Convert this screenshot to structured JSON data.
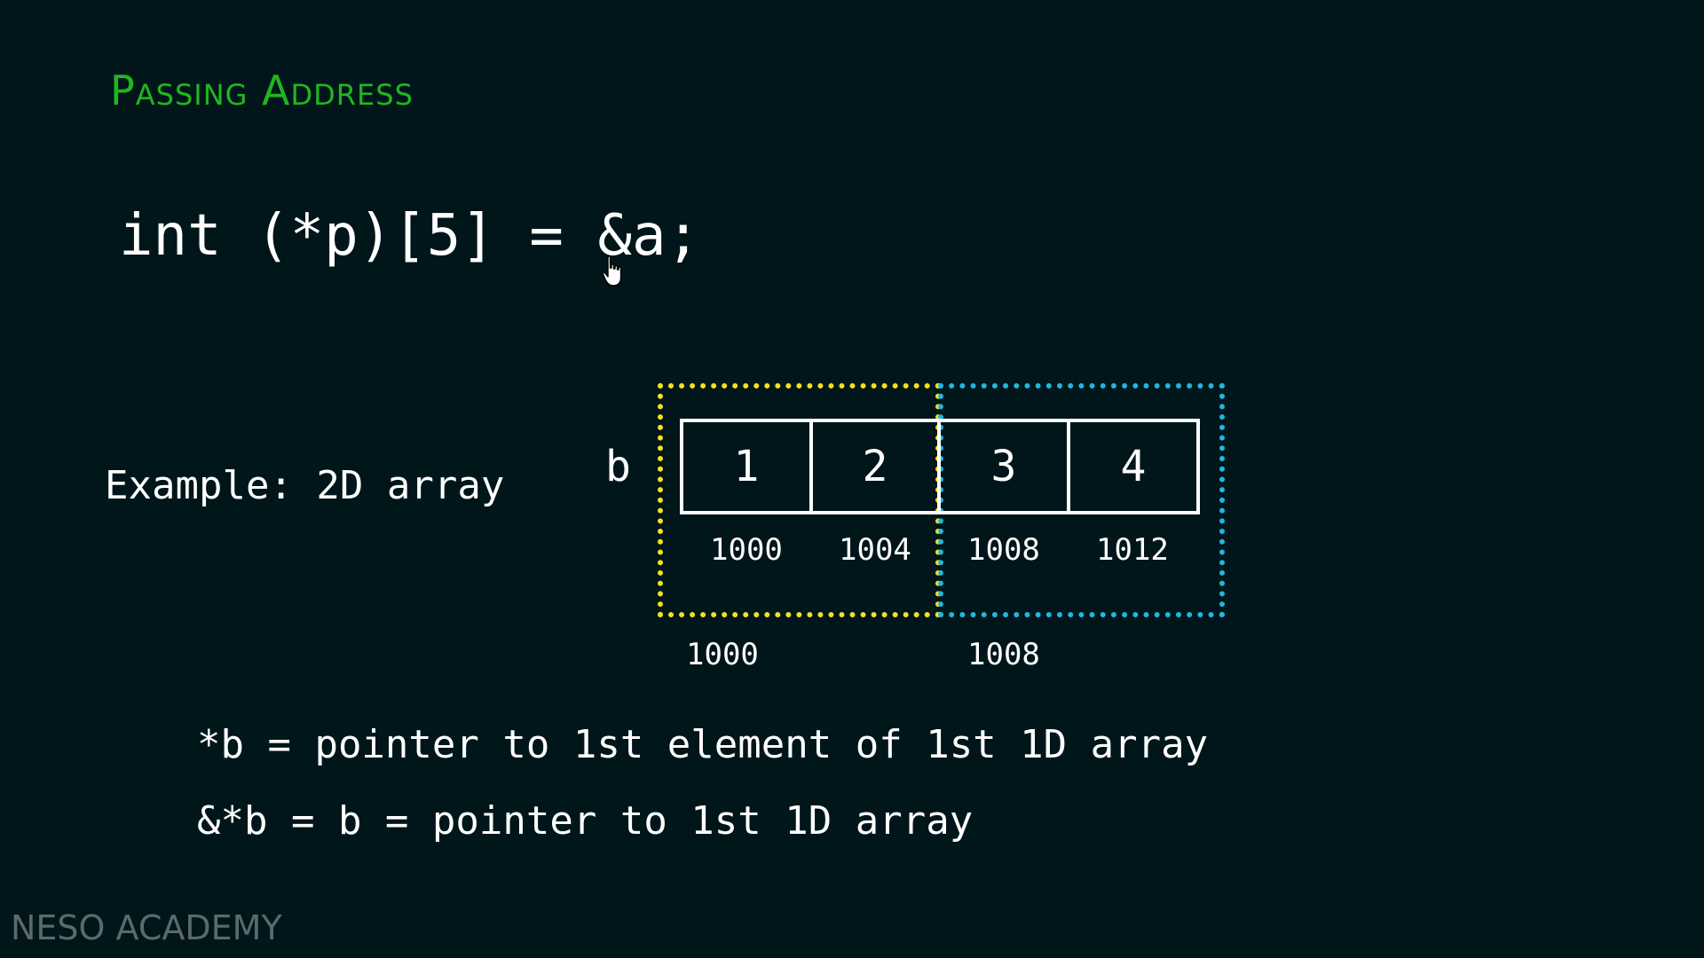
{
  "slide": {
    "title": "Passing Address",
    "code_line": "int (*p)[5] = &a;",
    "example_label": "Example: 2D array",
    "array_name": "b",
    "cells": [
      {
        "value": "1",
        "address": "1000"
      },
      {
        "value": "2",
        "address": "1004"
      },
      {
        "value": "3",
        "address": "1008"
      },
      {
        "value": "4",
        "address": "1012"
      }
    ],
    "row_addresses": [
      "1000",
      "1008"
    ],
    "explanations": [
      "*b = pointer to 1st element of 1st 1D array",
      "&*b = b = pointer to 1st 1D array"
    ],
    "watermark": "NESO ACADEMY"
  },
  "colors": {
    "background": "#01161a",
    "title": "#22b521",
    "row1_outline": "#f2e21f",
    "row2_outline": "#1fb8df",
    "text": "#ffffff",
    "watermark": "#5c6a6c"
  },
  "icons": {
    "cursor": "hand-pointer-icon"
  }
}
